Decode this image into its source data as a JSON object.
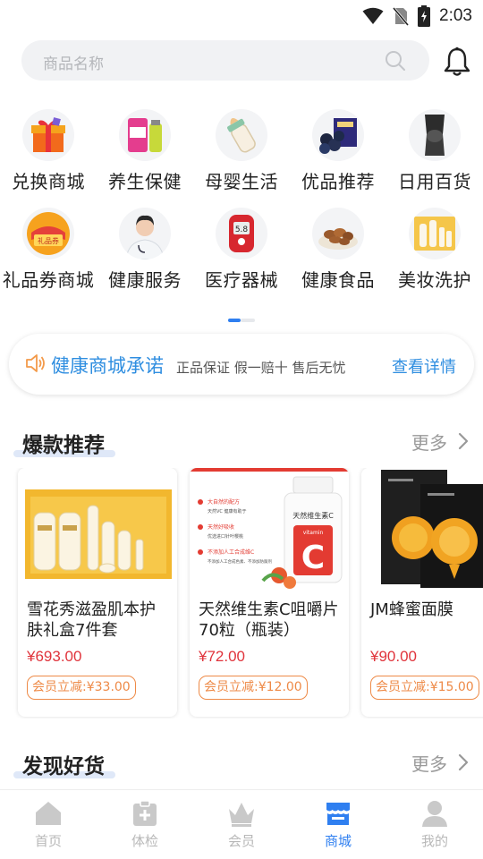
{
  "status_bar": {
    "time": "2:03"
  },
  "search": {
    "placeholder": "商品名称"
  },
  "categories": [
    {
      "label": "兑换商城",
      "icon": "gift-box-icon"
    },
    {
      "label": "养生保健",
      "icon": "supplement-bottle-icon"
    },
    {
      "label": "母婴生活",
      "icon": "baby-bottle-icon"
    },
    {
      "label": "优品推荐",
      "icon": "blueberry-box-icon"
    },
    {
      "label": "日用百货",
      "icon": "knee-brace-icon"
    },
    {
      "label": "礼品券商城",
      "icon": "gift-voucher-icon",
      "icon_text": "礼品券"
    },
    {
      "label": "健康服务",
      "icon": "doctor-icon"
    },
    {
      "label": "医疗器械",
      "icon": "glucose-meter-icon",
      "icon_text": "5.8"
    },
    {
      "label": "健康食品",
      "icon": "nuts-bowl-icon"
    },
    {
      "label": "美妆洗护",
      "icon": "cosmetics-set-icon"
    }
  ],
  "promise": {
    "title": "健康商城承诺",
    "description": "正品保证 假一赔十 售后无忧",
    "link": "查看详情"
  },
  "hot": {
    "title": "爆款推荐",
    "more": "更多"
  },
  "products": [
    {
      "name": "雪花秀滋盈肌本护肤礼盒7件套",
      "price": "¥693.00",
      "badge": "会员立减:¥33.00",
      "image": "skincare-gift-set-image"
    },
    {
      "name": "天然维生素C咀嚼片70粒（瓶装）",
      "price": "¥72.00",
      "badge": "会员立减:¥12.00",
      "image": "vitamin-c-bottle-image",
      "image_text": {
        "bottle_label": "天然维生素C",
        "bottle_letter": "C",
        "bottle_word": "vitamin",
        "lines": [
          "大自然的配方",
          "天然VC 健康有助于",
          "天然好吸收",
          "优选进口针叶樱桃",
          "不添加人工合成维C",
          "不添加人工合成色素、不添加防腐剂"
        ]
      }
    },
    {
      "name": "JM蜂蜜面膜",
      "price": "¥90.00",
      "badge": "会员立减:¥15.00",
      "image": "honey-mask-image"
    }
  ],
  "discover": {
    "title": "发现好货",
    "more": "更多"
  },
  "tabs": [
    {
      "label": "首页",
      "icon": "home-icon",
      "active": false
    },
    {
      "label": "体检",
      "icon": "checkup-icon",
      "active": false
    },
    {
      "label": "会员",
      "icon": "crown-icon",
      "active": false
    },
    {
      "label": "商城",
      "icon": "shop-icon",
      "active": true
    },
    {
      "label": "我的",
      "icon": "profile-icon",
      "active": false
    }
  ],
  "colors": {
    "accent": "#2f7ff0",
    "link": "#2f8ee0",
    "price": "#e0343c",
    "badge": "#ee8a47",
    "inactive_tab": "#b8b8b8"
  }
}
